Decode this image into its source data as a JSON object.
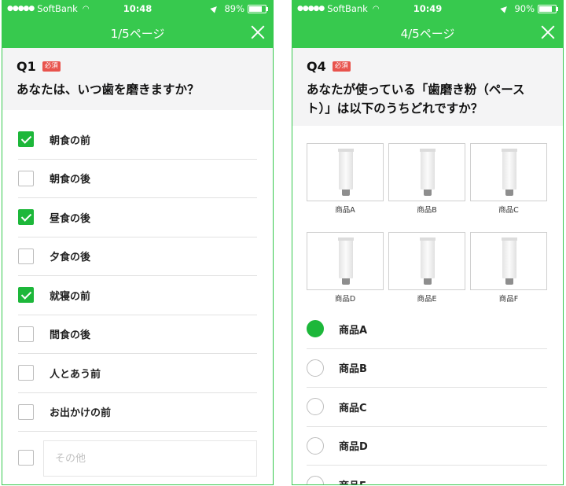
{
  "left": {
    "status": {
      "carrier": "SoftBank",
      "time": "10:48",
      "battery": "89%",
      "battery_level": 0.89
    },
    "nav": {
      "title": "1/5ページ"
    },
    "question": {
      "number": "Q1",
      "badge": "必須",
      "text": "あなたは、いつ歯を磨きますか？"
    },
    "options": [
      {
        "label": "朝食の前",
        "checked": true
      },
      {
        "label": "朝食の後",
        "checked": false
      },
      {
        "label": "昼食の後",
        "checked": true
      },
      {
        "label": "夕食の後",
        "checked": false
      },
      {
        "label": "就寝の前",
        "checked": true
      },
      {
        "label": "間食の後",
        "checked": false
      },
      {
        "label": "人とあう前",
        "checked": false
      },
      {
        "label": "お出かけの前",
        "checked": false
      }
    ],
    "other": {
      "placeholder": "その他",
      "checked": false
    }
  },
  "right": {
    "status": {
      "carrier": "SoftBank",
      "time": "10:49",
      "battery": "90%",
      "battery_level": 0.9
    },
    "nav": {
      "title": "4/5ページ"
    },
    "question": {
      "number": "Q4",
      "badge": "必須",
      "text": "あなたが使っている「歯磨き粉（ペースト）」は以下のうちどれですか？"
    },
    "products": [
      {
        "label": "商品A"
      },
      {
        "label": "商品B"
      },
      {
        "label": "商品C"
      },
      {
        "label": "商品D"
      },
      {
        "label": "商品E"
      },
      {
        "label": "商品F"
      }
    ],
    "options": [
      {
        "label": "商品A",
        "selected": true
      },
      {
        "label": "商品B",
        "selected": false
      },
      {
        "label": "商品C",
        "selected": false
      },
      {
        "label": "商品D",
        "selected": false
      },
      {
        "label": "商品E",
        "selected": false
      }
    ]
  },
  "colors": {
    "brand_green": "#37c94e",
    "check_green": "#1db73a",
    "required_red": "#e8534d"
  }
}
